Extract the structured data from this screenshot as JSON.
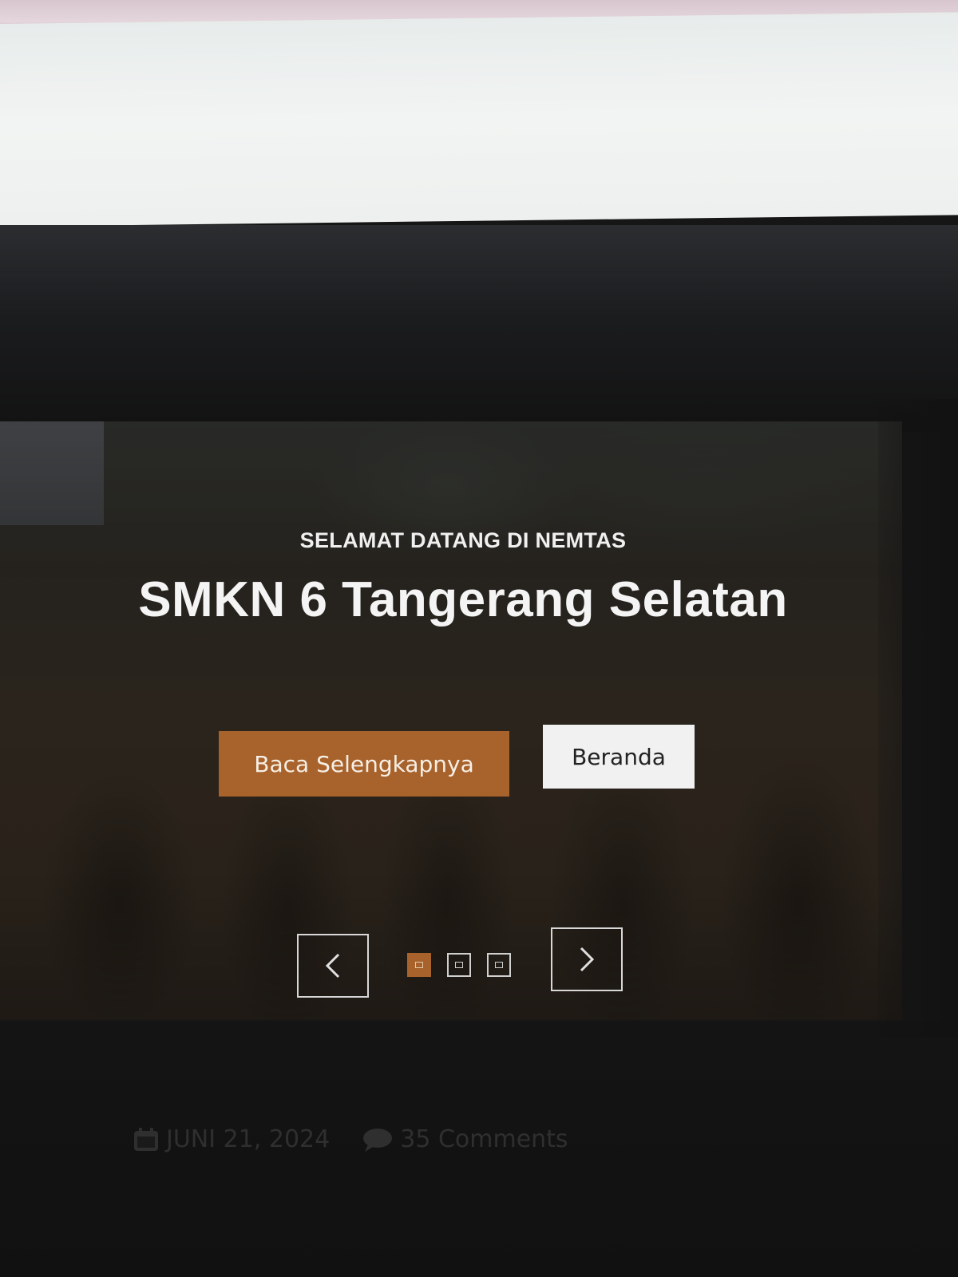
{
  "hero": {
    "subtitle": "SELAMAT DATANG DI NEMTAS",
    "title": "SMKN 6 Tangerang Selatan",
    "primary_button": "Baca Selengkapnya",
    "secondary_button": "Beranda",
    "slide_count": 3,
    "active_slide": 1
  },
  "meta": {
    "date": "JUNI 21, 2024",
    "comments": "35 Comments"
  },
  "colors": {
    "accent": "#a8622b",
    "header_bg": "#eef0ef",
    "page_bg": "#151515"
  },
  "icons": {
    "prev": "chevron-left-icon",
    "next": "chevron-right-icon",
    "date": "calendar-icon",
    "comments": "comment-icon"
  }
}
